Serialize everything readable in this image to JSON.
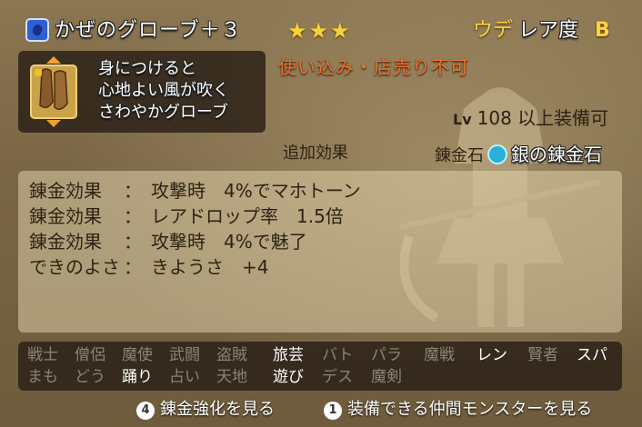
{
  "header": {
    "item_name": "かぜのグローブ＋３",
    "stars": "★★★",
    "ude_label": "ウデ",
    "rarity_label": "レア度",
    "rarity_grade": "B"
  },
  "item": {
    "description": "身につけると\n心地よい風が吹く\nさわやかグローブ",
    "icon": "glove-icon"
  },
  "notice": "使い込み・店売り不可",
  "level": {
    "label": "Lv",
    "value": "108",
    "suffix": "以上装備可"
  },
  "extra_effect_label": "追加効果",
  "rensei": {
    "label": "錬金石",
    "stone_icon": "silver-alchemy-stone-icon",
    "stone_name": "銀の錬金石"
  },
  "effects": [
    {
      "label": "錬金効果",
      "value": "攻撃時　4%でマホトーン"
    },
    {
      "label": "錬金効果",
      "value": "レアドロップ率　1.5倍"
    },
    {
      "label": "錬金効果",
      "value": "攻撃時　4%で魅了"
    },
    {
      "label": "できのよさ",
      "value": "きようさ　+4"
    }
  ],
  "jobs": [
    {
      "name": "戦士",
      "enabled": false
    },
    {
      "name": "僧侶",
      "enabled": false
    },
    {
      "name": "魔使",
      "enabled": false
    },
    {
      "name": "武闘",
      "enabled": false
    },
    {
      "name": "盗賊",
      "enabled": false
    },
    {
      "name": "旅芸",
      "enabled": true
    },
    {
      "name": "バト",
      "enabled": false
    },
    {
      "name": "パラ",
      "enabled": false
    },
    {
      "name": "魔戦",
      "enabled": false
    },
    {
      "name": "レン",
      "enabled": true
    },
    {
      "name": "賢者",
      "enabled": false
    },
    {
      "name": "スパ",
      "enabled": true
    },
    {
      "name": "まも",
      "enabled": false
    },
    {
      "name": "どう",
      "enabled": false
    },
    {
      "name": "踊り",
      "enabled": true
    },
    {
      "name": "占い",
      "enabled": false
    },
    {
      "name": "天地",
      "enabled": false
    },
    {
      "name": "遊び",
      "enabled": true
    },
    {
      "name": "デス",
      "enabled": false
    },
    {
      "name": "魔剣",
      "enabled": false
    }
  ],
  "footer": {
    "btn1_key": "4",
    "btn1_label": "錬金強化を見る",
    "btn2_key": "1",
    "btn2_label": "装備できる仲間モンスターを見る"
  },
  "colors": {
    "enabled_job": "#ffffff",
    "disabled_job": "#8d8474",
    "notice": "#f0702a",
    "rarity": "#ffd33d"
  }
}
